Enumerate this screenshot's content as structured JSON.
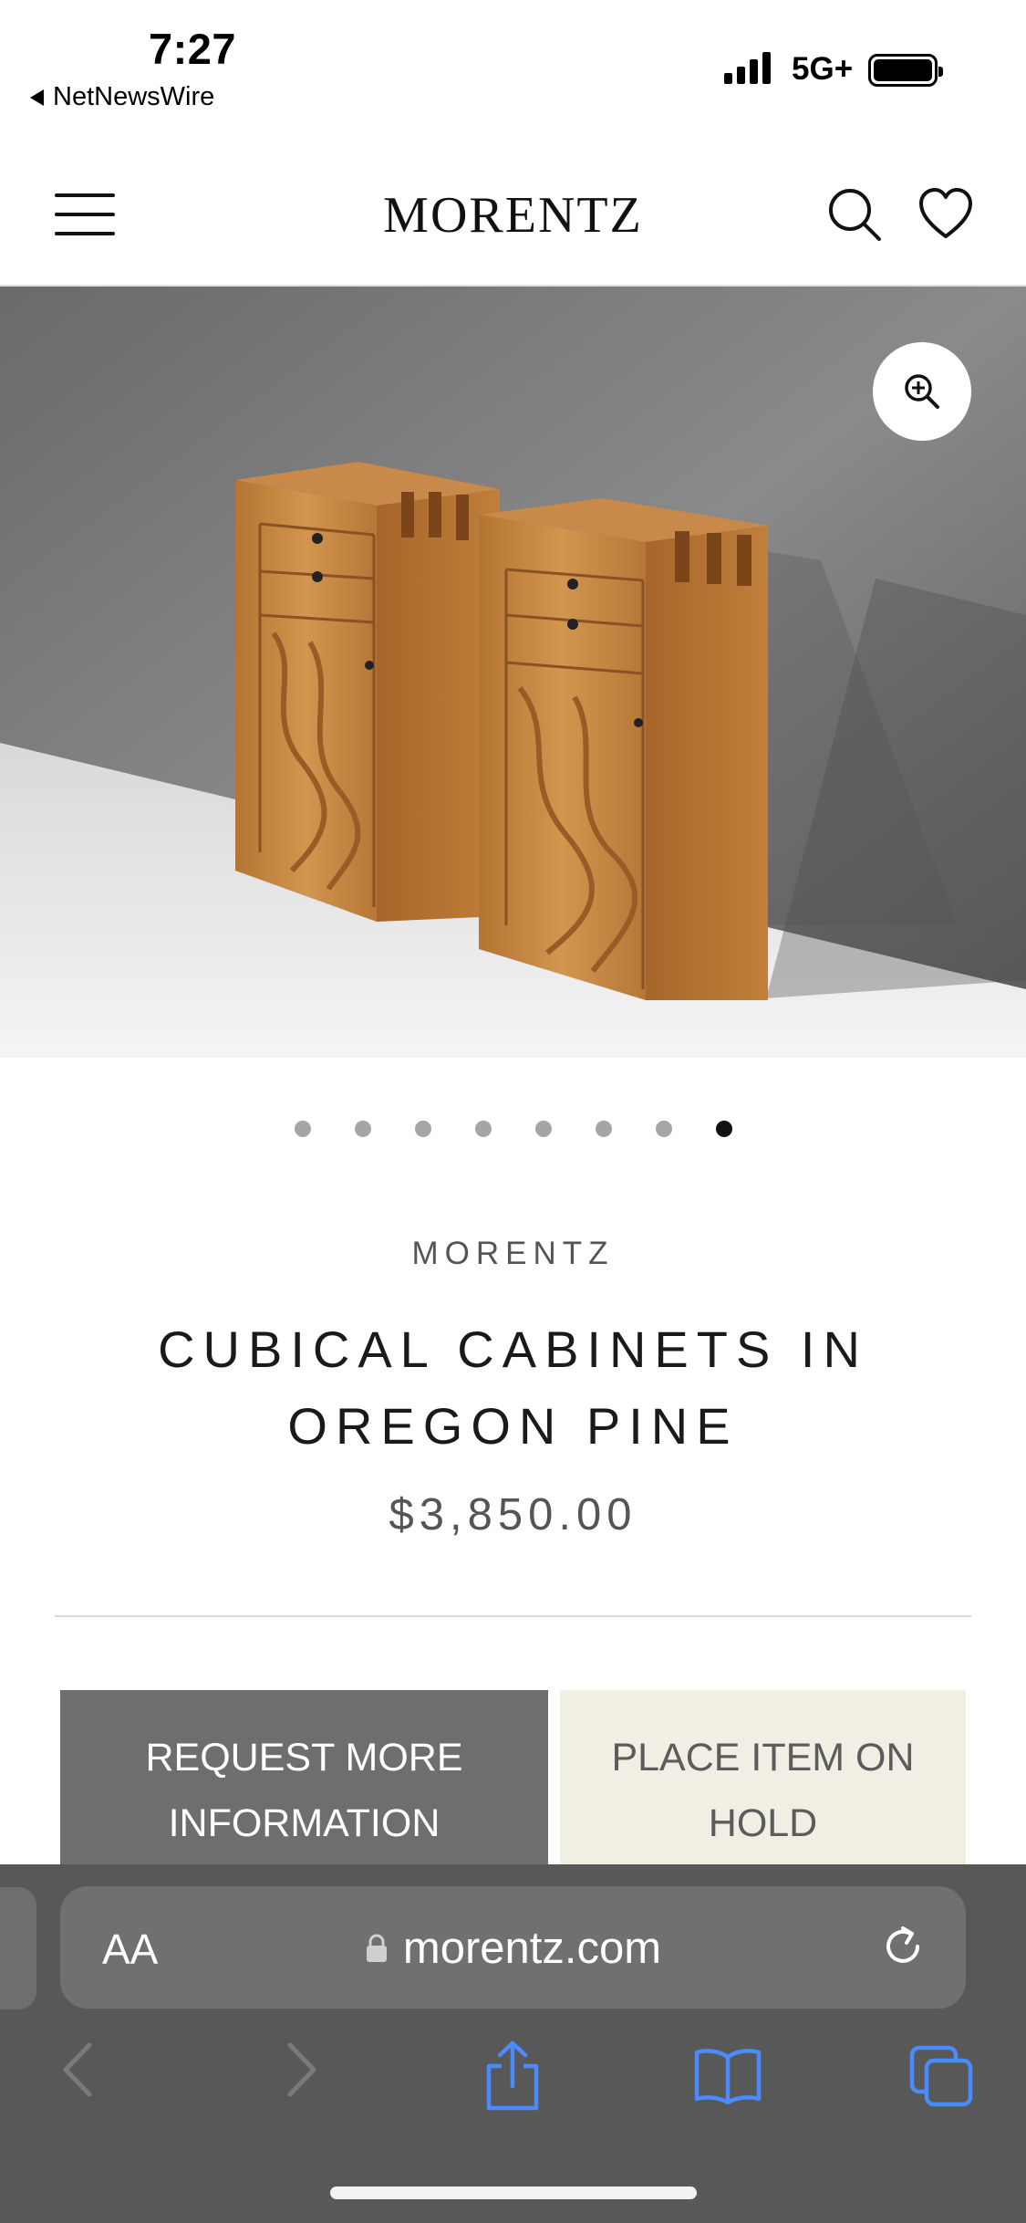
{
  "status_bar": {
    "time": "7:27",
    "back_app": "NetNewsWire",
    "network": "5G+",
    "battery_level": 1.0
  },
  "header": {
    "logo": "MORENTZ",
    "icons": [
      "hamburger-menu-icon",
      "search-icon",
      "heart-icon"
    ]
  },
  "gallery": {
    "total_images": 8,
    "active_index": 8,
    "zoom_icon": "zoom-in-icon"
  },
  "product": {
    "brand": "MORENTZ",
    "title_line_1": "CUBICAL CABINETS IN",
    "title_line_2": "OREGON PINE",
    "price": "$3,850.00"
  },
  "actions": {
    "request_line_1": "REQUEST MORE",
    "request_line_2": "INFORMATION",
    "hold_line_1": "PLACE ITEM ON",
    "hold_line_2": "HOLD"
  },
  "browser": {
    "text_size_label": "AA",
    "url": "morentz.com",
    "toolbar": [
      "back-icon",
      "forward-icon",
      "share-icon",
      "bookmarks-icon",
      "tabs-icon"
    ]
  },
  "colors": {
    "request_button_bg": "#6e6e6e",
    "hold_button_bg": "#f1eee4",
    "safari_bar_bg": "#585858",
    "toolbar_accent": "#4a8cff",
    "wood": "#c0813c"
  }
}
